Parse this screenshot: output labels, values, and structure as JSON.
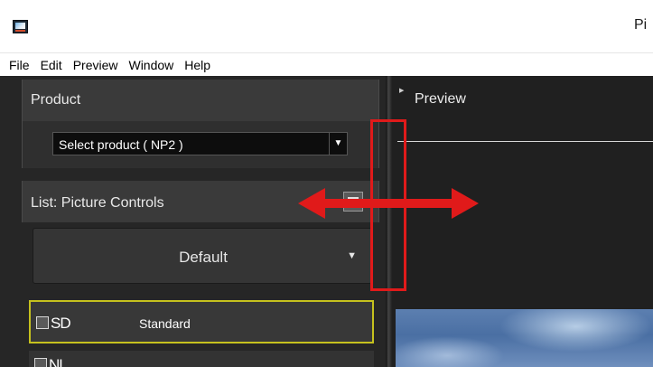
{
  "window": {
    "title": "Pi",
    "icon": "picture-control-app-icon"
  },
  "menu": {
    "items": [
      "File",
      "Edit",
      "Preview",
      "Window",
      "Help"
    ]
  },
  "product_panel": {
    "title": "Product",
    "select_value": "Select product ( NP2 )"
  },
  "list_panel": {
    "title": "List: Picture Controls",
    "filter_value": "Default",
    "items": [
      {
        "code": "SD",
        "name": "Standard",
        "selected": true
      },
      {
        "code": "NL",
        "name": "",
        "selected": false
      }
    ]
  },
  "preview_panel": {
    "title": "Preview"
  },
  "colors": {
    "panel_bg": "#262626",
    "selection_border": "#c5c11e",
    "annotation_red": "#e01a1a"
  }
}
